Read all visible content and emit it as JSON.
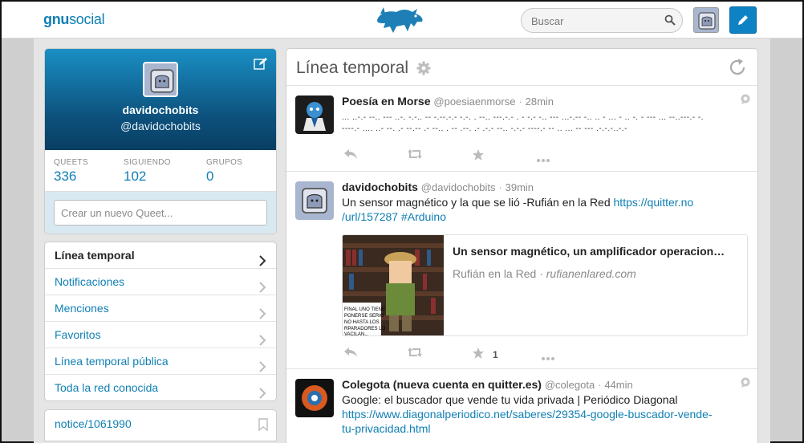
{
  "header": {
    "logo_part1": "gnu",
    "logo_part2": "social",
    "search_placeholder": "Buscar",
    "accent": "#0f7fb3"
  },
  "profile": {
    "name": "davidochobits",
    "handle": "@davidochobits",
    "stats": [
      {
        "label": "QUEETS",
        "value": "336"
      },
      {
        "label": "SIGUIENDO",
        "value": "102"
      },
      {
        "label": "GRUPOS",
        "value": "0"
      }
    ],
    "compose_placeholder": "Crear un nuevo Queet..."
  },
  "menu": {
    "items": [
      {
        "label": "Línea temporal",
        "active": true
      },
      {
        "label": "Notificaciones"
      },
      {
        "label": "Menciones"
      },
      {
        "label": "Favoritos"
      },
      {
        "label": "Línea temporal pública"
      },
      {
        "label": "Toda la red conocida"
      }
    ]
  },
  "notice": {
    "label": "notice/1061990"
  },
  "timeline": {
    "title": "Línea temporal",
    "queets": [
      {
        "name": "Poesía en Morse",
        "handle": "@poesiaenmorse",
        "time": "28min",
        "line1": "... ..-.- --.. --- ..-. -.-.. -- -.--.-.- -.-. . --.. ---.-.- . - -.- -.. --- ...-.-- -.. .. - ... - .. -. - --- ... --..---.- -.",
        "line2": "----.- .... ..- --. .- --.-- .- --.. . -- .--. .- .-.- --.. -.-.- ----.- -- .. ... -- --- .-.-.-..-.-"
      },
      {
        "name": "davidochobits",
        "handle": "@davidochobits",
        "time": "39min",
        "text": "Un sensor magnético y la que se lió -Rufián en la Red ",
        "link1": "https://quitter.no",
        "link2": "/url/157287",
        "hashtag": "#Arduino",
        "card_title": "Un sensor magnético, un amplificador operacion…",
        "card_source": "Rufián en la Red",
        "card_domain": "rufianenlared.com",
        "card_thumb_text": "FINAL UNO TIENE\n PONERSE SERIO\nNO HASTA LOS\nRPARADORES LO\n VACILAN...",
        "fav_count": "1"
      },
      {
        "name": "Colegota (nueva cuenta en quitter.es)",
        "handle": "@colegota",
        "time": "44min",
        "text": "Google: el buscador que vende tu vida privada | Periódico Diagonal",
        "link1": "https://www.diagonalperiodico.net/saberes/29354-google-buscador-vende-",
        "link2": "tu-privacidad.html"
      }
    ]
  }
}
